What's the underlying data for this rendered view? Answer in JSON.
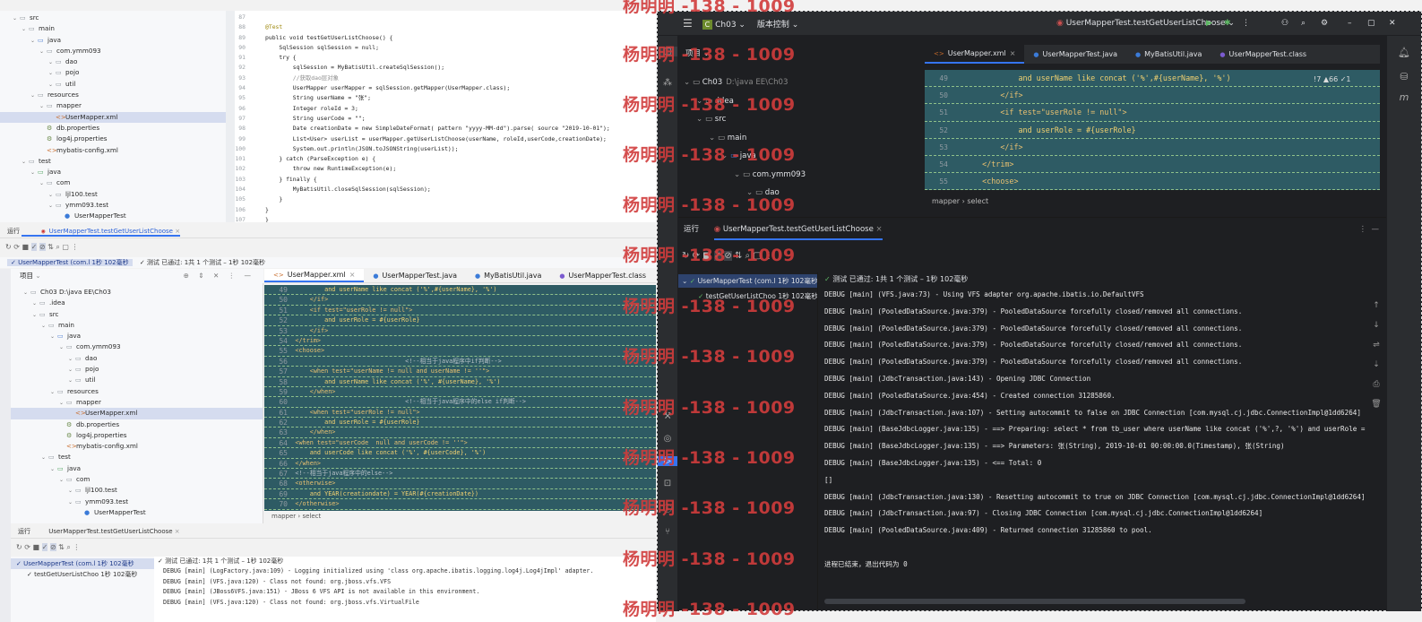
{
  "watermark": "杨明明 -138 - 1009",
  "top_left": {
    "tree": [
      {
        "label": "src",
        "depth": 1,
        "icon": "folder"
      },
      {
        "label": "main",
        "depth": 2,
        "icon": "folder"
      },
      {
        "label": "java",
        "depth": 3,
        "icon": "folder-blue"
      },
      {
        "label": "com.ymm093",
        "depth": 4,
        "icon": "package"
      },
      {
        "label": "dao",
        "depth": 5,
        "icon": "package"
      },
      {
        "label": "pojo",
        "depth": 5,
        "icon": "package"
      },
      {
        "label": "util",
        "depth": 5,
        "icon": "package"
      },
      {
        "label": "resources",
        "depth": 3,
        "icon": "folder"
      },
      {
        "label": "mapper",
        "depth": 4,
        "icon": "folder"
      },
      {
        "label": "UserMapper.xml",
        "depth": 5,
        "icon": "xml",
        "selected": true
      },
      {
        "label": "db.properties",
        "depth": 4,
        "icon": "props"
      },
      {
        "label": "log4j.properties",
        "depth": 4,
        "icon": "props"
      },
      {
        "label": "mybatis-config.xml",
        "depth": 4,
        "icon": "xml"
      },
      {
        "label": "test",
        "depth": 2,
        "icon": "folder"
      },
      {
        "label": "java",
        "depth": 3,
        "icon": "folder-green"
      },
      {
        "label": "com",
        "depth": 4,
        "icon": "package"
      },
      {
        "label": "ljl100.test",
        "depth": 5,
        "icon": "package"
      },
      {
        "label": "ymm093.test",
        "depth": 5,
        "icon": "package"
      },
      {
        "label": "UserMapperTest",
        "depth": 6,
        "icon": "class"
      }
    ],
    "code": [
      {
        "n": "87",
        "t": ""
      },
      {
        "n": "88",
        "t": "@Test",
        "c": "an"
      },
      {
        "n": "89",
        "t": "public void testGetUserListChoose() {"
      },
      {
        "n": "90",
        "t": "    SqlSession sqlSession = null;"
      },
      {
        "n": "91",
        "t": "    try {"
      },
      {
        "n": "92",
        "t": "        sqlSession = MyBatisUtil.createSqlSession();"
      },
      {
        "n": "93",
        "t": "        //获取dao层对象",
        "c": "cm"
      },
      {
        "n": "94",
        "t": "        UserMapper userMapper = sqlSession.getMapper(UserMapper.class);"
      },
      {
        "n": "95",
        "t": "        String userName = \"张\";"
      },
      {
        "n": "96",
        "t": "        Integer roleId = 3;"
      },
      {
        "n": "97",
        "t": "        String userCode = \"\";"
      },
      {
        "n": "98",
        "t": "        Date creationDate = new SimpleDateFormat( pattern \"yyyy-MM-dd\").parse( source \"2019-10-01\");"
      },
      {
        "n": "99",
        "t": "        List<User> userList = userMapper.getUserListChoose(userName, roleId,userCode,creationDate);"
      },
      {
        "n": "100",
        "t": "        System.out.println(JSON.toJSONString(userList));"
      },
      {
        "n": "101",
        "t": "    } catch (ParseException e) {"
      },
      {
        "n": "102",
        "t": "        throw new RuntimeException(e);"
      },
      {
        "n": "103",
        "t": "    } finally {"
      },
      {
        "n": "104",
        "t": "        MyBatisUtil.closeSqlSession(sqlSession);"
      },
      {
        "n": "105",
        "t": "    }"
      },
      {
        "n": "106",
        "t": "}"
      },
      {
        "n": "107",
        "t": "}"
      }
    ],
    "run_tab": "运行",
    "run_config": "UserMapperTest.testGetUserListChoose",
    "test_node": "UserMapperTest (com.l 1秒 102毫秒",
    "test_status": "测试 已通过: 1共 1 个测试 – 1秒 102毫秒"
  },
  "mid_left": {
    "project_label": "项目",
    "tree": [
      {
        "label": "Ch03 D:\\java EE\\Ch03",
        "depth": 1,
        "icon": "folder"
      },
      {
        "label": ".idea",
        "depth": 2,
        "icon": "folder"
      },
      {
        "label": "src",
        "depth": 2,
        "icon": "folder"
      },
      {
        "label": "main",
        "depth": 3,
        "icon": "folder"
      },
      {
        "label": "java",
        "depth": 4,
        "icon": "folder-blue"
      },
      {
        "label": "com.ymm093",
        "depth": 5,
        "icon": "package"
      },
      {
        "label": "dao",
        "depth": 6,
        "icon": "package"
      },
      {
        "label": "pojo",
        "depth": 6,
        "icon": "package"
      },
      {
        "label": "util",
        "depth": 6,
        "icon": "package"
      },
      {
        "label": "resources",
        "depth": 4,
        "icon": "folder"
      },
      {
        "label": "mapper",
        "depth": 5,
        "icon": "folder"
      },
      {
        "label": "UserMapper.xml",
        "depth": 6,
        "icon": "xml",
        "selected": true
      },
      {
        "label": "db.properties",
        "depth": 5,
        "icon": "props"
      },
      {
        "label": "log4j.properties",
        "depth": 5,
        "icon": "props"
      },
      {
        "label": "mybatis-config.xml",
        "depth": 5,
        "icon": "xml"
      },
      {
        "label": "test",
        "depth": 3,
        "icon": "folder"
      },
      {
        "label": "java",
        "depth": 4,
        "icon": "folder-green"
      },
      {
        "label": "com",
        "depth": 5,
        "icon": "package"
      },
      {
        "label": "ljl100.test",
        "depth": 6,
        "icon": "package"
      },
      {
        "label": "ymm093.test",
        "depth": 6,
        "icon": "package"
      },
      {
        "label": "UserMapperTest",
        "depth": 7,
        "icon": "class"
      }
    ],
    "tabs": [
      "UserMapper.xml",
      "UserMapperTest.java",
      "MyBatisUtil.java",
      "UserMapperTest.class"
    ],
    "xml": [
      {
        "n": "49",
        "t": "            and userName like concat ('%',#{userName}, '%')"
      },
      {
        "n": "50",
        "t": "        </if>"
      },
      {
        "n": "51",
        "t": "        <if test=\"userRole != null\">"
      },
      {
        "n": "52",
        "t": "            and userRole = #{userRole}"
      },
      {
        "n": "53",
        "t": "        </if>"
      },
      {
        "n": "54",
        "t": "    </trim>"
      },
      {
        "n": "55",
        "t": "    <choose>"
      },
      {
        "n": "56",
        "t": "                                  <!--相当于java程序中if判断-->"
      },
      {
        "n": "57",
        "t": "        <when test=\"userName != null and userName != ''\">"
      },
      {
        "n": "58",
        "t": "            and userName like concat ('%', #{userName}, '%')"
      },
      {
        "n": "59",
        "t": "        </when>"
      },
      {
        "n": "60",
        "t": "                                  <!--相当于java程序中的else if判断-->"
      },
      {
        "n": "61",
        "t": "        <when test=\"userRole != null\">"
      },
      {
        "n": "62",
        "t": "            and userRole = #{userRole}"
      },
      {
        "n": "63",
        "t": "        </when>"
      },
      {
        "n": "64",
        "t": "    <when test=\"userCode  null and userCode != ''\">"
      },
      {
        "n": "65",
        "t": "        and userCode like concat ('%', #{userCode}, '%')"
      },
      {
        "n": "66",
        "t": "    </when>"
      },
      {
        "n": "67",
        "t": "    <!--相当于java程序中的else-->"
      },
      {
        "n": "68",
        "t": "    <otherwise>"
      },
      {
        "n": "69",
        "t": "        and YEAR(creationdate) = YEAR(#{creationDate})"
      },
      {
        "n": "70",
        "t": "    </otherwise>"
      }
    ],
    "breadcrumb": [
      "mapper",
      "select"
    ]
  },
  "bottom_left": {
    "run_tab": "运行",
    "run_config": "UserMapperTest.testGetUserListChoose",
    "test_node": "UserMapperTest (com.l 1秒 102毫秒",
    "test_child": "testGetUserListChoo 1秒 102毫秒",
    "test_status": "测试 已通过: 1共 1 个测试 – 1秒 102毫秒",
    "log": [
      "DEBUG [main] (LogFactory.java:109) - Logging initialized using 'class org.apache.ibatis.logging.log4j.Log4jImpl' adapter.",
      "DEBUG [main] (VFS.java:120) - Class not found: org.jboss.vfs.VFS",
      "DEBUG [main] (JBoss6VFS.java:151) - JBoss 6 VFS API is not available in this environment.",
      "DEBUG [main] (VFS.java:120) - Class not found: org.jboss.vfs.VirtualFile"
    ]
  },
  "right": {
    "project_name": "Ch03",
    "vcs": "版本控制",
    "run_config": "UserMapperTest.testGetUserListChoose",
    "project_label": "项目",
    "tree": [
      {
        "label": "Ch03",
        "sub": "D:\\java EE\\Ch03",
        "depth": 0
      },
      {
        "label": ".idea",
        "depth": 1
      },
      {
        "label": "src",
        "depth": 1
      },
      {
        "label": "main",
        "depth": 2
      },
      {
        "label": "java",
        "depth": 3
      },
      {
        "label": "com.ymm093",
        "depth": 4
      },
      {
        "label": "dao",
        "depth": 5
      }
    ],
    "tabs": [
      "UserMapper.xml",
      "UserMapperTest.java",
      "MyBatisUtil.java",
      "UserMapperTest.class"
    ],
    "inspections": "!7  ▲66  ✓1",
    "xml": [
      {
        "n": "49",
        "t": "            and userName like concat ('%',#{userName}, '%')"
      },
      {
        "n": "50",
        "t": "        </if>"
      },
      {
        "n": "51",
        "t": "        <if test=\"userRole != null\">"
      },
      {
        "n": "52",
        "t": "            and userRole = #{userRole}"
      },
      {
        "n": "53",
        "t": "        </if>"
      },
      {
        "n": "54",
        "t": "    </trim>"
      },
      {
        "n": "55",
        "t": "    <choose>"
      }
    ],
    "breadcrumb": [
      "mapper",
      "select"
    ],
    "run_tab": "运行",
    "run_config_tab": "UserMapperTest.testGetUserListChoose",
    "test_status": "测试 已通过: 1共 1 个测试 – 1秒 102毫秒",
    "test_node": "UserMapperTest (com.l 1秒 102毫秒",
    "test_child": "testGetUserListChoo 1秒 102毫秒",
    "log": [
      "DEBUG [main] (VFS.java:73) - Using VFS adapter org.apache.ibatis.io.DefaultVFS",
      "DEBUG [main] (PooledDataSource.java:379) - PooledDataSource forcefully closed/removed all connections.",
      "DEBUG [main] (PooledDataSource.java:379) - PooledDataSource forcefully closed/removed all connections.",
      "DEBUG [main] (PooledDataSource.java:379) - PooledDataSource forcefully closed/removed all connections.",
      "DEBUG [main] (PooledDataSource.java:379) - PooledDataSource forcefully closed/removed all connections.",
      "DEBUG [main] (JdbcTransaction.java:143) - Opening JDBC Connection",
      "DEBUG [main] (PooledDataSource.java:454) - Created connection 31285860.",
      "DEBUG [main] (JdbcTransaction.java:107) - Setting autocommit to false on JDBC Connection [com.mysql.cj.jdbc.ConnectionImpl@1dd6264]",
      "DEBUG [main] (BaseJdbcLogger.java:135) - ==>  Preparing: select * from tb_user where userName like concat ('%',?, '%') and userRole = ? an",
      "DEBUG [main] (BaseJdbcLogger.java:135) - ==> Parameters: 张(String), 2019-10-01 00:00:00.0(Timestamp), 张(String)",
      "DEBUG [main] (BaseJdbcLogger.java:135) - <==      Total: 0",
      "[]",
      "DEBUG [main] (JdbcTransaction.java:130) - Resetting autocommit to true on JDBC Connection [com.mysql.cj.jdbc.ConnectionImpl@1dd6264]",
      "DEBUG [main] (JdbcTransaction.java:97) - Closing JDBC Connection [com.mysql.cj.jdbc.ConnectionImpl@1dd6264]",
      "DEBUG [main] (PooledDataSource.java:409) - Returned connection 31285860 to pool.",
      "",
      "进程已结束，退出代码为 0"
    ]
  }
}
